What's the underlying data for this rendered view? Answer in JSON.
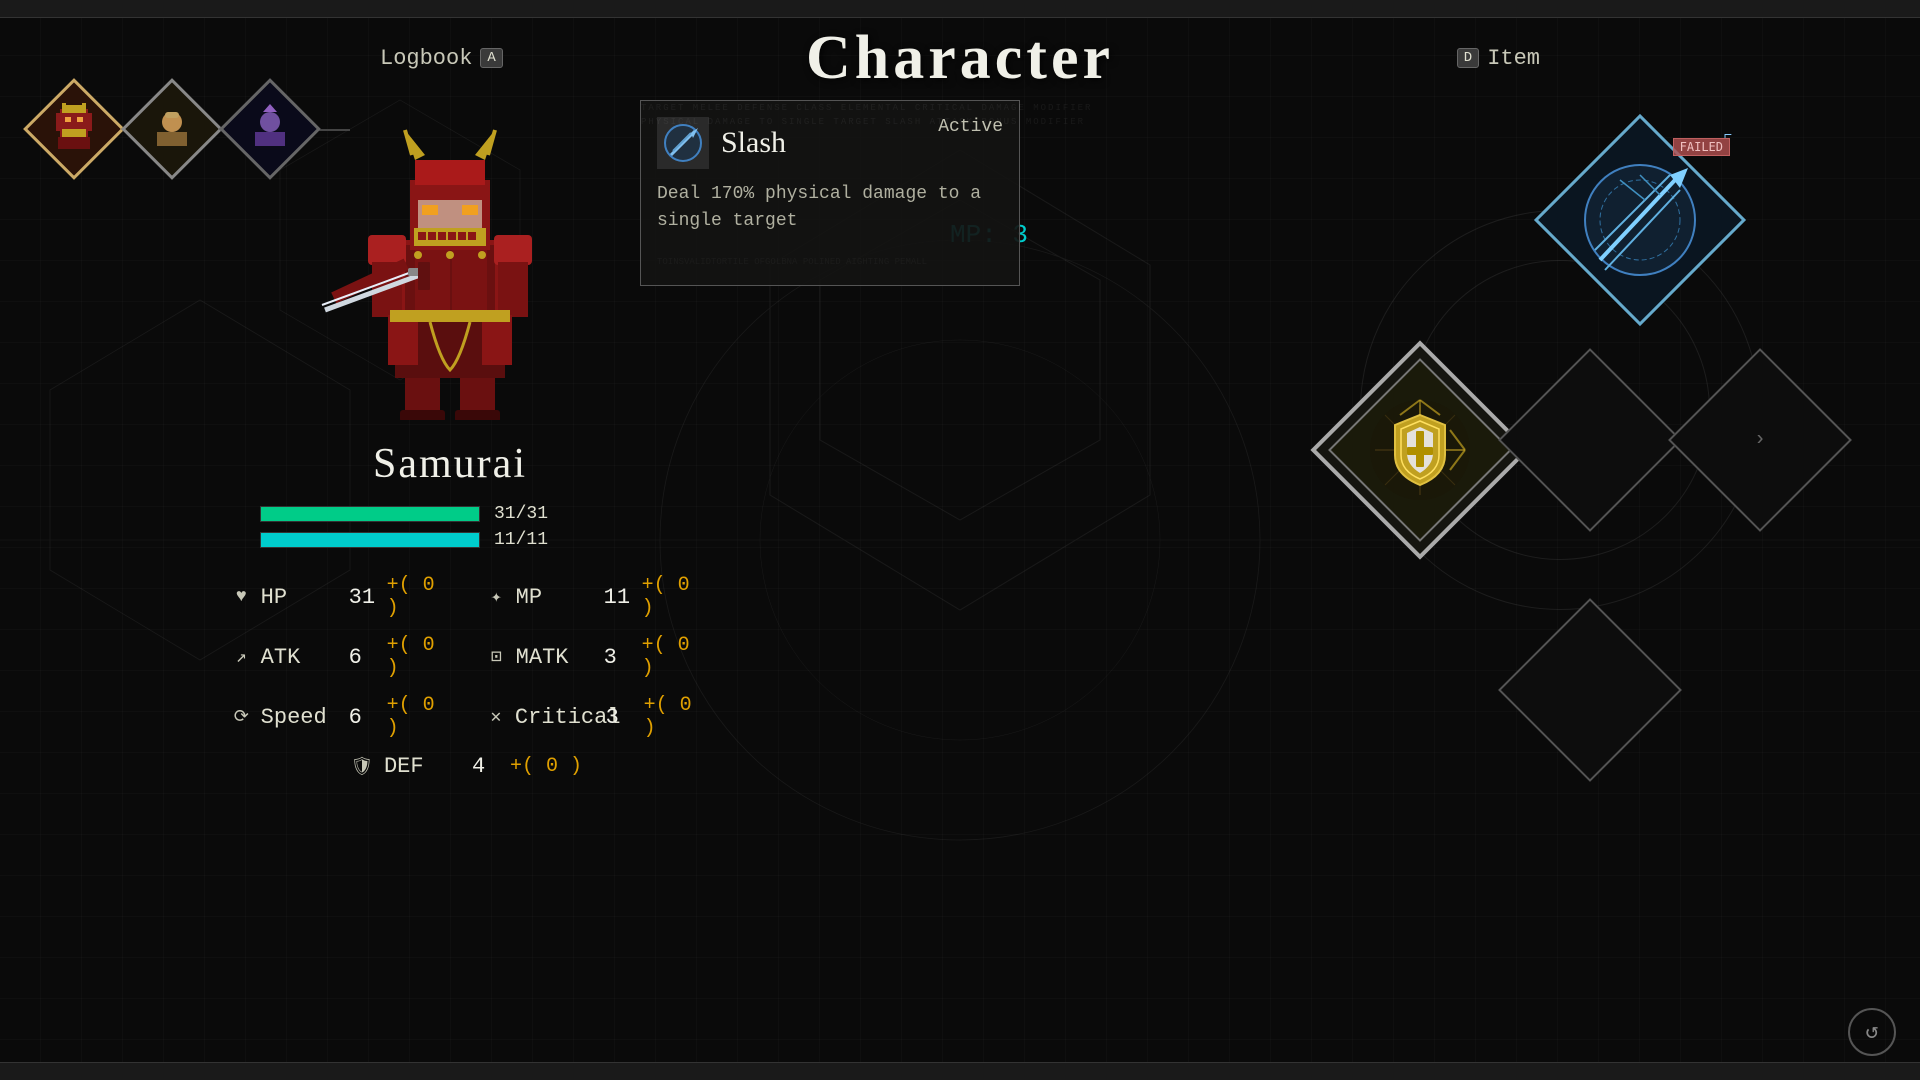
{
  "header": {
    "title": "Character",
    "nav_left_label": "Logbook",
    "nav_left_key": "A",
    "nav_right_label": "Item",
    "nav_right_key": "D"
  },
  "party": [
    {
      "id": "samurai",
      "active": true,
      "color": "#8a2020"
    },
    {
      "id": "archer",
      "active": false,
      "color": "#c0a030"
    },
    {
      "id": "mage",
      "active": false,
      "color": "#6030a0"
    }
  ],
  "character": {
    "name": "Samurai",
    "hp_current": 31,
    "hp_max": 31,
    "mp_current": 11,
    "mp_max": 11,
    "stats": {
      "hp": {
        "label": "HP",
        "value": 31,
        "bonus": "+( 0 )"
      },
      "mp": {
        "label": "MP",
        "value": 11,
        "bonus": "+( 0 )"
      },
      "atk": {
        "label": "ATK",
        "value": 6,
        "bonus": "+( 0 )"
      },
      "matk": {
        "label": "MATK",
        "value": 3,
        "bonus": "+( 0 )"
      },
      "speed": {
        "label": "Speed",
        "value": 6,
        "bonus": "+( 0 )"
      },
      "critical": {
        "label": "Critical",
        "value": 3,
        "bonus": "+( 0 )"
      },
      "def": {
        "label": "DEF",
        "value": 4,
        "bonus": "+( 0 )"
      }
    }
  },
  "skill_tooltip": {
    "name": "Slash",
    "type": "Active",
    "description": "Deal 170% physical damage to a single target",
    "mp_cost": "MP: 3"
  },
  "slots": {
    "top_label": "FAILED",
    "empty_label": ""
  },
  "corner": {
    "icon": "↺"
  }
}
